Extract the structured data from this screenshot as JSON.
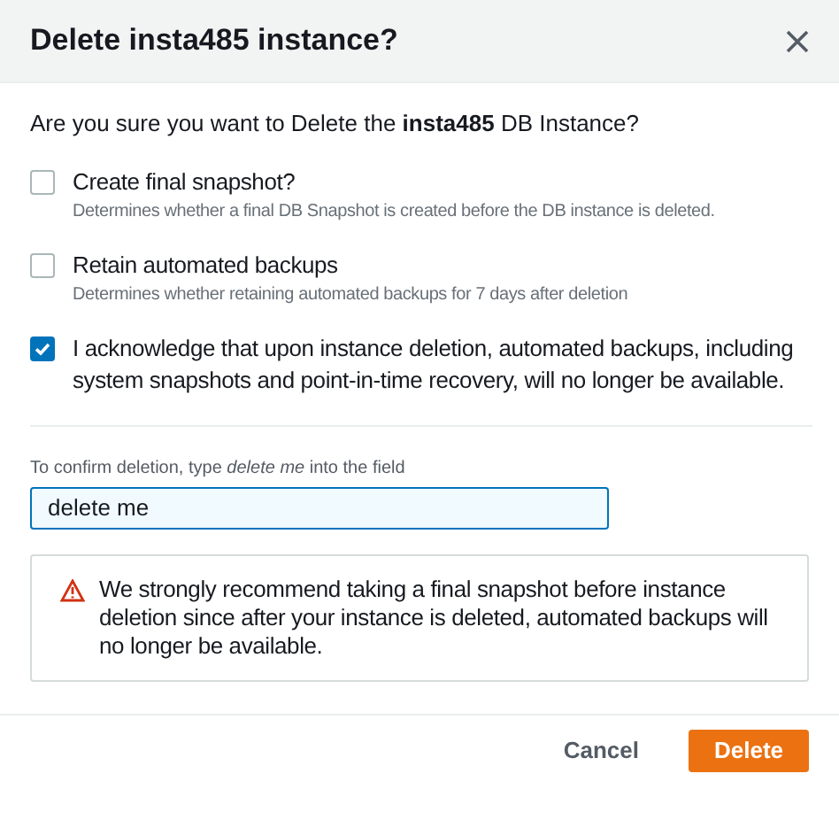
{
  "dialog": {
    "title": "Delete insta485 instance?",
    "prompt": "Are you sure you want to Delete the **insta485** DB Instance?"
  },
  "options": [
    {
      "label": "Create final snapshot?",
      "description": "Determines whether a final DB Snapshot is created before the DB instance is deleted.",
      "checked": false
    },
    {
      "label": "Retain automated backups",
      "description": "Determines whether retaining automated backups for 7 days after deletion",
      "checked": false
    },
    {
      "label": "I acknowledge that upon instance deletion, automated backups, including system snapshots and point-in-time recovery, will no longer be available.",
      "checked": true
    }
  ],
  "confirm": {
    "label": "To confirm deletion, type *delete me* into the field",
    "value": "delete me"
  },
  "warning": "We strongly recommend taking a final snapshot before instance deletion since after your instance is deleted, automated backups will no longer be available.",
  "buttons": {
    "cancel": "Cancel",
    "delete": "Delete"
  }
}
